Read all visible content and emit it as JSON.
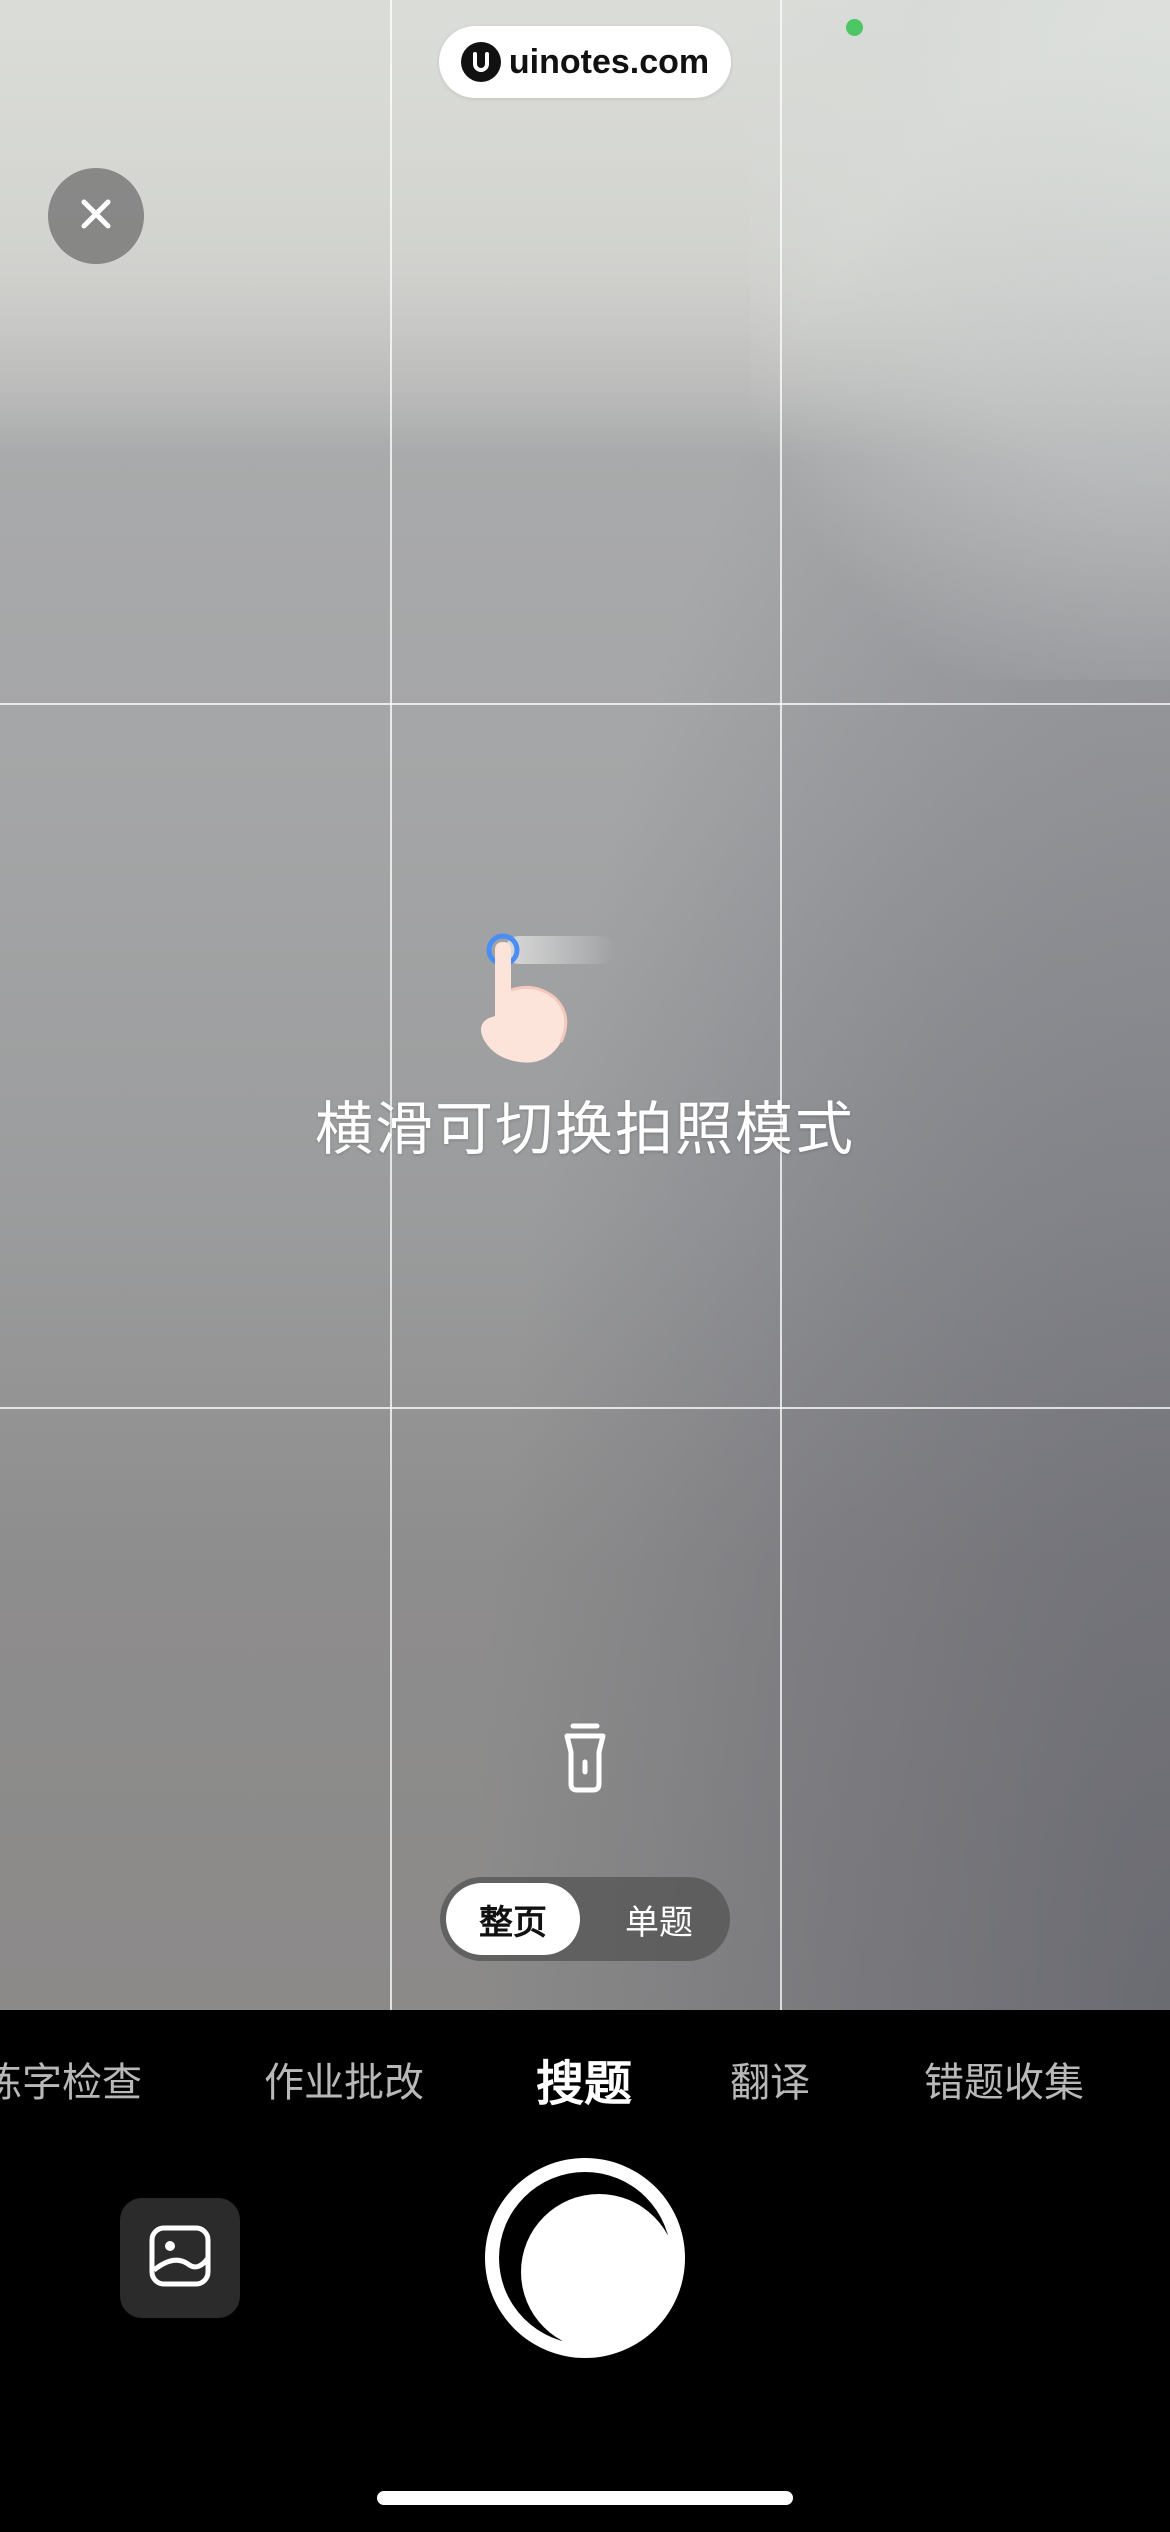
{
  "watermark": {
    "text": "uinotes.com",
    "icon": "uinotes-logo-icon"
  },
  "status": {
    "indicator_color": "#4cc764",
    "icon": "camera-active-dot"
  },
  "controls": {
    "close_icon": "close-icon",
    "flashlight_icon": "flashlight-icon",
    "gallery_icon": "image-gallery-icon"
  },
  "hint": {
    "text": "横滑可切换拍照模式",
    "icon": "swipe-hand-icon"
  },
  "capture_mode_toggle": {
    "options": [
      {
        "label": "整页",
        "selected": true
      },
      {
        "label": "单题",
        "selected": false
      }
    ]
  },
  "mode_tabs": {
    "items": [
      {
        "label": "练字检查",
        "active": false
      },
      {
        "label": "作业批改",
        "active": false
      },
      {
        "label": "搜题",
        "active": true
      },
      {
        "label": "翻译",
        "active": false
      },
      {
        "label": "错题收集",
        "active": false
      }
    ]
  },
  "colors": {
    "accent": "#ffffff",
    "background": "#000000",
    "inactive_tab": "#b8b8b8"
  }
}
